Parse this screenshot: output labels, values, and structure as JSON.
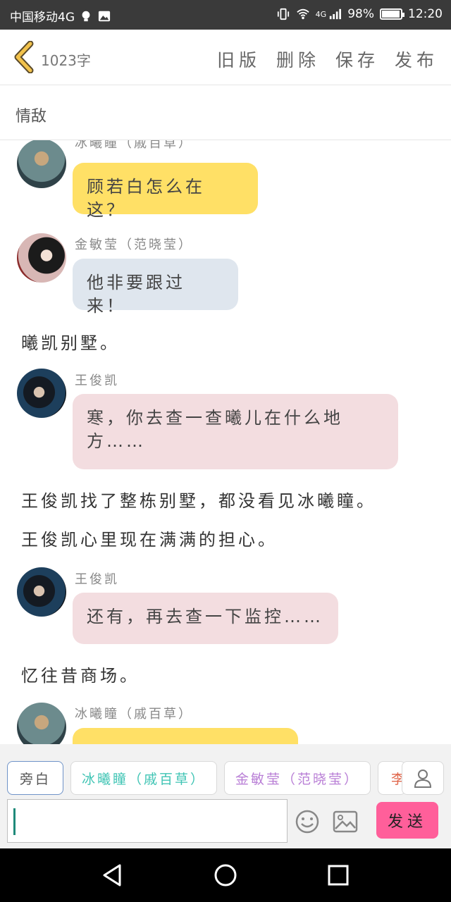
{
  "status": {
    "carrier": "中国移动4G",
    "network": "4G",
    "battery": "98%",
    "time": "12:20"
  },
  "topbar": {
    "word_count": "1023字",
    "actions": [
      "旧版",
      "删除",
      "保存",
      "发布"
    ]
  },
  "title": "情敌",
  "messages": [
    {
      "speaker": "冰曦瞳（戚百草）",
      "text": "顾若白怎么在这？"
    },
    {
      "speaker": "金敏莹（范晓莹）",
      "text": "他非要跟过来！"
    },
    {
      "narration": "曦凯别墅。"
    },
    {
      "speaker": "王俊凯",
      "text": "寒，你去查一查曦儿在什么地方……"
    },
    {
      "narration": "王俊凯找了整栋别墅，都没看见冰曦瞳。"
    },
    {
      "narration": "王俊凯心里现在满满的担心。"
    },
    {
      "speaker": "王俊凯",
      "text": "还有，再去查一下监控……"
    },
    {
      "narration": "忆往昔商场。"
    },
    {
      "speaker": "冰曦瞳（戚百草）",
      "text": ""
    }
  ],
  "characters": [
    "旁白",
    "冰曦瞳（戚百草）",
    "金敏莹（范晓莹）",
    "李"
  ],
  "input": {
    "value": ""
  },
  "send_label": "发送",
  "colors": {
    "bubble_yellow": "#ffe066",
    "bubble_blue": "#dfe6ee",
    "bubble_pink": "#f3dde0",
    "send": "#ff5f9a"
  }
}
